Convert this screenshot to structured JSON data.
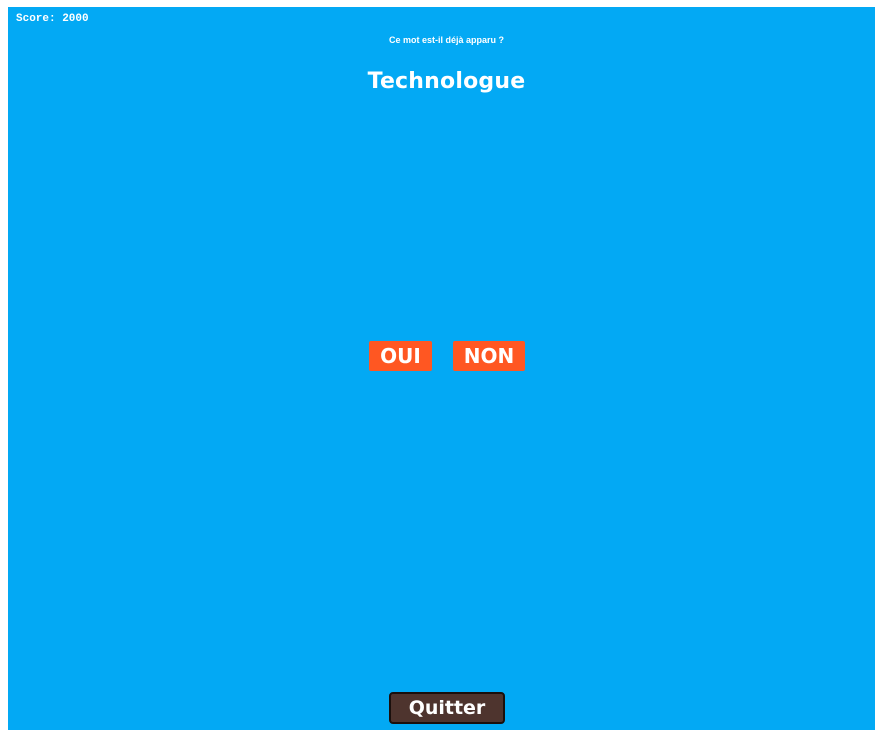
{
  "game": {
    "score_text": "Score: 2000",
    "question": "Ce mot est-il déjà apparu ?",
    "word": "Technologue"
  },
  "buttons": {
    "yes_label": "OUI",
    "no_label": "NON",
    "quit_label": "Quitter"
  },
  "colors": {
    "background": "#03a9f4",
    "answer_button": "#ff5722",
    "quit_button": "#4e342e",
    "text": "#ffffff"
  }
}
